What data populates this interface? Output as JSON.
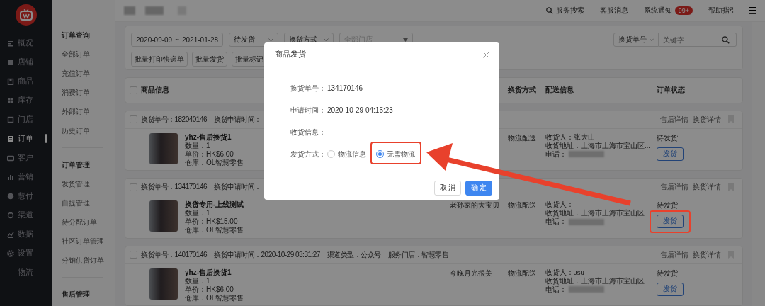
{
  "sidebar": {
    "items": [
      {
        "label": "概况",
        "selected": false
      },
      {
        "label": "店铺",
        "selected": false
      },
      {
        "label": "商品",
        "selected": false
      },
      {
        "label": "库存",
        "selected": false
      },
      {
        "label": "门店",
        "selected": false
      },
      {
        "label": "订单",
        "selected": true
      },
      {
        "label": "客户",
        "selected": false
      },
      {
        "label": "营销",
        "selected": false
      },
      {
        "label": "慧付",
        "selected": false
      },
      {
        "label": "渠道",
        "selected": false
      },
      {
        "label": "数据",
        "selected": false
      },
      {
        "label": "设置",
        "selected": false
      },
      {
        "label": "物流",
        "selected": false
      }
    ]
  },
  "subnav": {
    "groups": [
      {
        "title": "订单查询",
        "items": [
          "全部订单",
          "充值订单",
          "消费订单",
          "外部订单",
          "历史订单"
        ]
      },
      {
        "title": "订单管理",
        "items": [
          "发货管理",
          "自提管理",
          "待分配订单",
          "社区订单管理",
          "分销供货订单"
        ]
      },
      {
        "title": "售后管理"
      }
    ]
  },
  "topbar": {
    "links": [
      {
        "label": "服务搜索",
        "kind": "search"
      },
      {
        "label": "客服消息",
        "kind": "plain"
      },
      {
        "label": "系统通知",
        "kind": "badge",
        "badge": "99+"
      },
      {
        "label": "帮助指引",
        "kind": "plain"
      }
    ]
  },
  "filters": {
    "date_start": "2020-09-09",
    "date_sep": "~",
    "date_end": "2021-01-28",
    "status": "待发货",
    "method": "换货方式",
    "store_placeholder": "全部门店",
    "search_type": "换货单号",
    "search_placeholder": "关键字",
    "batch_buttons": [
      "批量打印快递单",
      "批量发货",
      "批量标记"
    ]
  },
  "table": {
    "all_checked": false,
    "columns": [
      "商品信息",
      "换货方式",
      "配送信息",
      "订单状态"
    ],
    "orders": [
      {
        "checked": false,
        "order_no": "换货单号：182040146",
        "time": "换货申请时间：",
        "actions": [
          "售后详情",
          "换货详情"
        ],
        "product": {
          "name": "yhz-售后换货1",
          "qty": "数量：1",
          "price": "单价：HK$6.00",
          "warehouse": "仓库：OL智慧零售"
        },
        "method": "物流配送",
        "consignee": "收货人：张大山",
        "address": "收货地址：上海市上海市宝山区...",
        "phone": "电话：",
        "status": "待发货",
        "ship_button": "发货"
      },
      {
        "checked": false,
        "order_no": "换货单号：134170146",
        "time": "换货申请时间：",
        "actions": [
          "售后详情",
          "换货详情"
        ],
        "product": {
          "name": "换货专用-上线测试",
          "qty": "数量：1",
          "price": "单价：HK$15.00",
          "warehouse": "仓库：OL智慧零售"
        },
        "buyer": "老孙家的大宝贝",
        "method": "物流配送",
        "consignee": "收货人：",
        "address": "收货地址：上海市上海市宝山区...",
        "phone": "电话：",
        "status": "待发货",
        "ship_button": "发货"
      },
      {
        "checked": false,
        "order_no": "换货单号：140170146",
        "time": "换货申请时间：2020-10-29 03:31:27",
        "channel": "渠道类型：公众号",
        "store": "服务门店：智慧零售",
        "actions": [
          "售后详情",
          "换货详情"
        ],
        "product": {
          "name": "yhz-售后换货1",
          "qty": "数量：1",
          "price": "单价：HK$6.00",
          "warehouse": "仓库：OL智慧零售"
        },
        "buyer": "今晚月光很美",
        "method": "物流配送",
        "consignee": "收货人：Jsu",
        "address": "收货地址：上海市上海市宝山区...",
        "phone": "电话：",
        "status": "待发货",
        "ship_button": "发货"
      }
    ]
  },
  "dialog": {
    "title": "商品发货",
    "fields": [
      {
        "label": "换货单号：",
        "value": "134170146"
      },
      {
        "label": "申请时间：",
        "value": "2020-10-29 04:15:23"
      },
      {
        "label": "收货信息："
      }
    ],
    "ship_method": {
      "label": "发货方式：",
      "options": [
        {
          "label": "物流信息",
          "selected": false
        },
        {
          "label": "无需物流",
          "selected": true
        }
      ]
    },
    "buttons": [
      {
        "label": "取 消",
        "kind": "default"
      },
      {
        "label": "确 定",
        "kind": "primary"
      }
    ]
  }
}
